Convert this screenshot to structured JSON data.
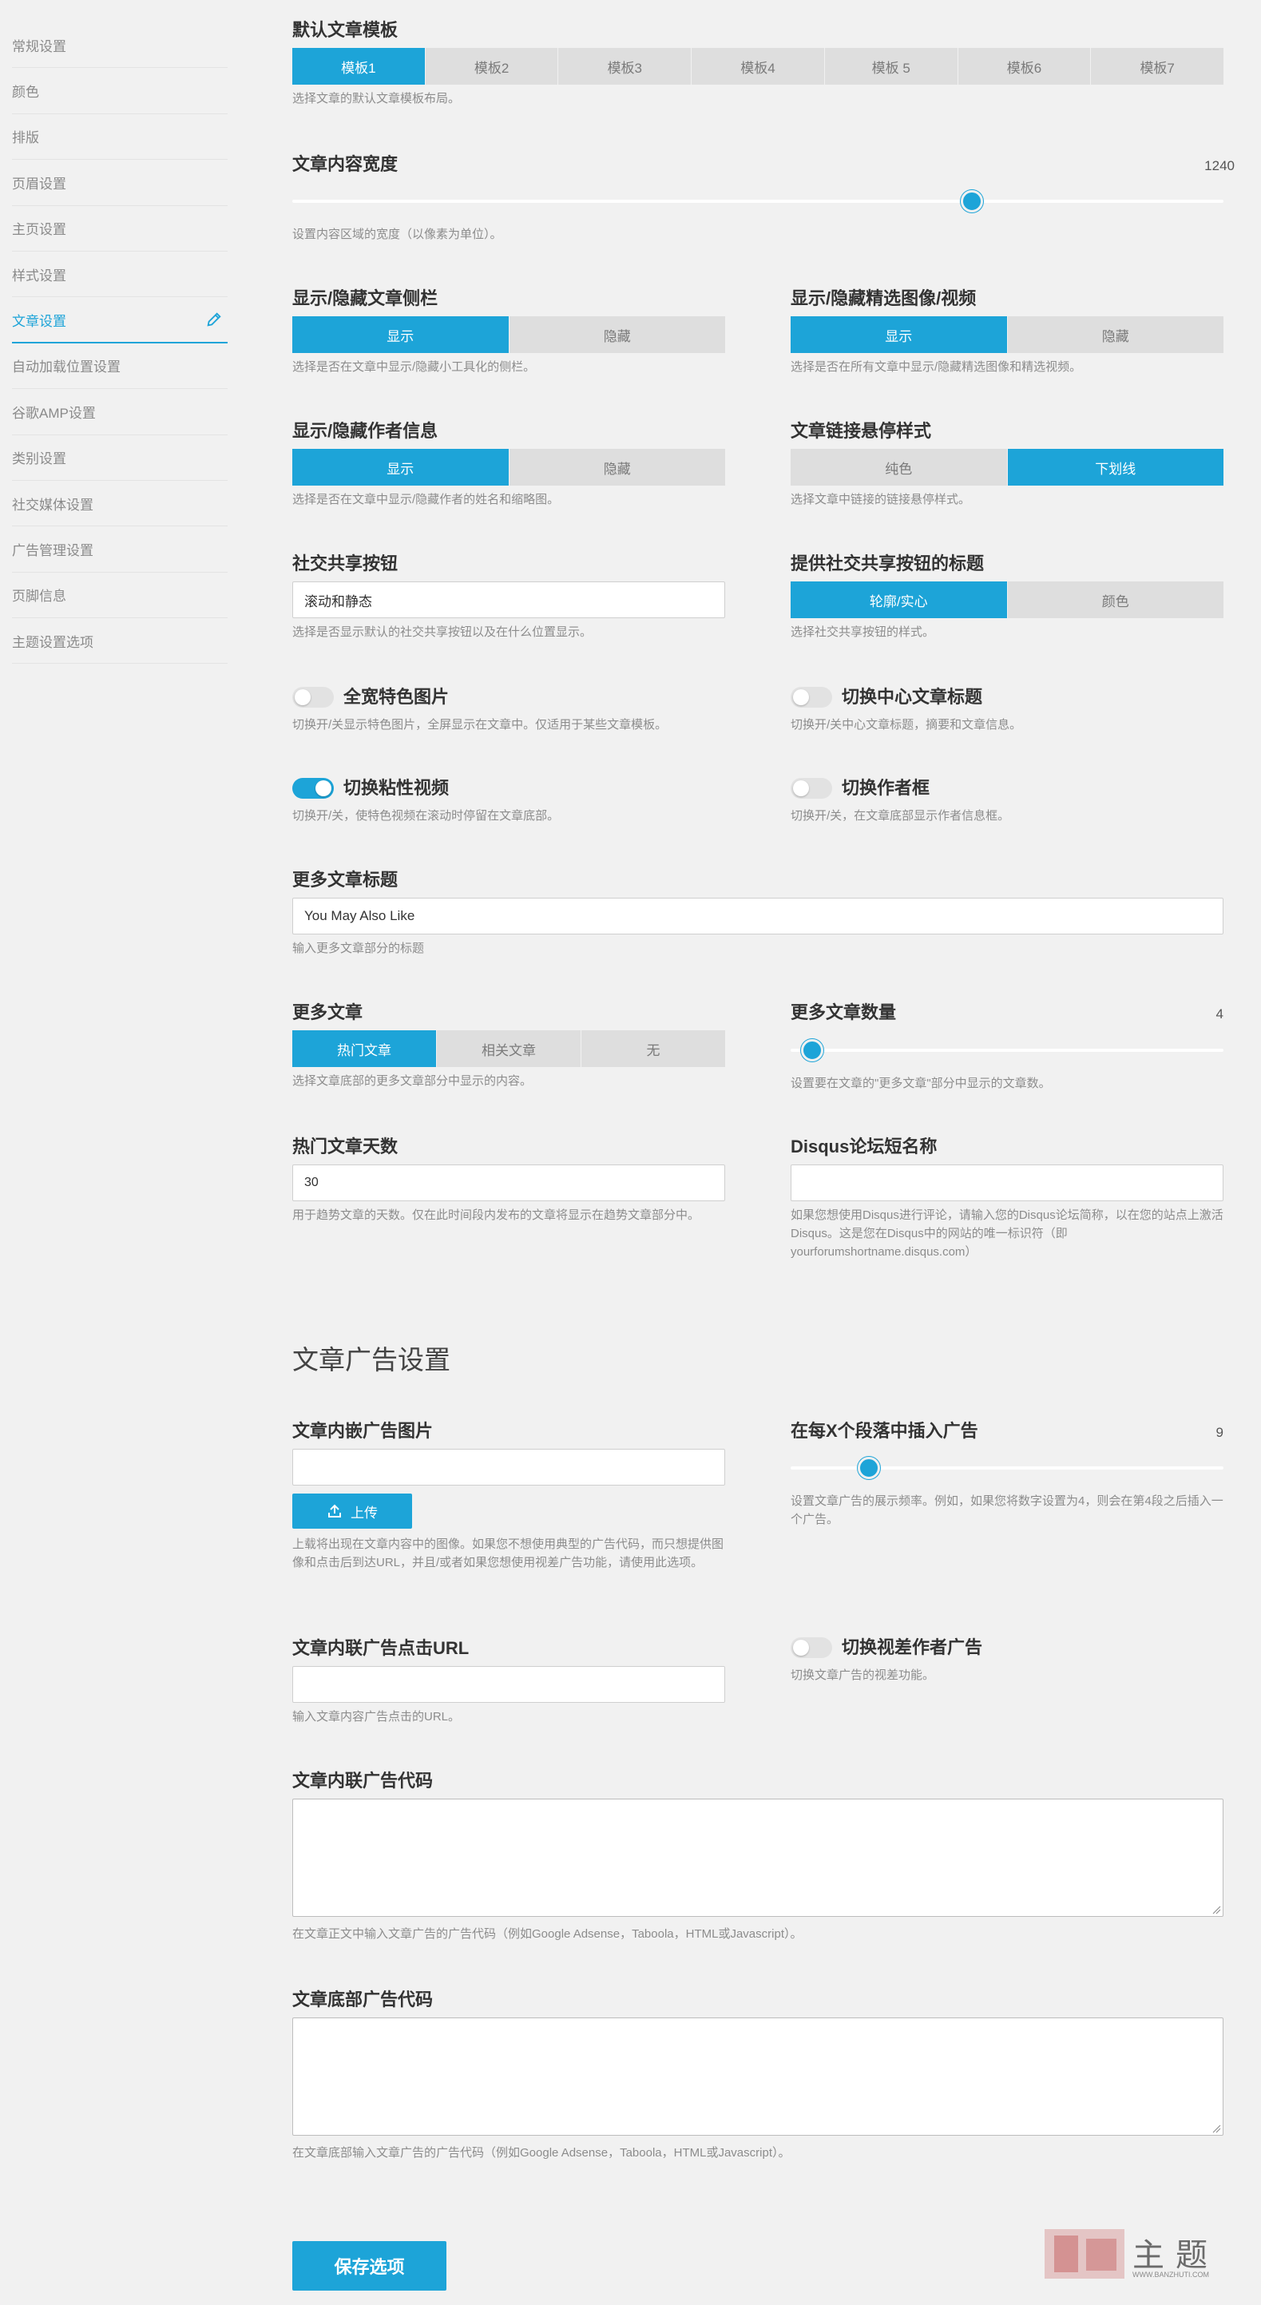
{
  "sidebar": {
    "items": [
      {
        "label": "常规设置"
      },
      {
        "label": "颜色"
      },
      {
        "label": "排版"
      },
      {
        "label": "页眉设置"
      },
      {
        "label": "主页设置"
      },
      {
        "label": "样式设置"
      },
      {
        "label": "文章设置",
        "active": true
      },
      {
        "label": "自动加载位置设置"
      },
      {
        "label": "谷歌AMP设置"
      },
      {
        "label": "类别设置"
      },
      {
        "label": "社交媒体设置"
      },
      {
        "label": "广告管理设置"
      },
      {
        "label": "页脚信息"
      },
      {
        "label": "主题设置选项"
      }
    ]
  },
  "template": {
    "label": "默认文章模板",
    "options": [
      "模板1",
      "模板2",
      "模板3",
      "模板4",
      "模板 5",
      "模板6",
      "模板7"
    ],
    "selected": 0,
    "desc": "选择文章的默认文章模板布局。"
  },
  "content_width": {
    "label": "文章内容宽度",
    "value": "1240",
    "fraction": 0.73,
    "desc": "设置内容区域的宽度（以像素为单位）。"
  },
  "sidebar_toggle": {
    "label": "显示/隐藏文章侧栏",
    "options": [
      "显示",
      "隐藏"
    ],
    "desc": "选择是否在文章中显示/隐藏小工具化的侧栏。"
  },
  "featured_toggle": {
    "label": "显示/隐藏精选图像/视频",
    "options": [
      "显示",
      "隐藏"
    ],
    "desc": "选择是否在所有文章中显示/隐藏精选图像和精选视频。"
  },
  "author_info": {
    "label": "显示/隐藏作者信息",
    "options": [
      "显示",
      "隐藏"
    ],
    "desc": "选择是否在文章中显示/隐藏作者的姓名和缩略图。"
  },
  "link_hover": {
    "label": "文章链接悬停样式",
    "options": [
      "纯色",
      "下划线"
    ],
    "desc": "选择文章中链接的链接悬停样式。"
  },
  "share_buttons": {
    "label": "社交共享按钮",
    "value": "滚动和静态",
    "desc": "选择是否显示默认的社交共享按钮以及在什么位置显示。"
  },
  "share_title": {
    "label": "提供社交共享按钮的标题",
    "options": [
      "轮廓/实心",
      "颜色"
    ],
    "desc": "选择社交共享按钮的样式。"
  },
  "full_width_image": {
    "label": "全宽特色图片",
    "on": false,
    "desc": "切换开/关显示特色图片，全屏显示在文章中。仅适用于某些文章模板。"
  },
  "center_title": {
    "label": "切换中心文章标题",
    "on": false,
    "desc": "切换开/关中心文章标题，摘要和文章信息。"
  },
  "sticky_video": {
    "label": "切换粘性视频",
    "on": true,
    "desc": "切换开/关，使特色视频在滚动时停留在文章底部。"
  },
  "author_box": {
    "label": "切换作者框",
    "on": false,
    "desc": "切换开/关，在文章底部显示作者信息框。"
  },
  "more_title": {
    "label": "更多文章标题",
    "value": "You May Also Like",
    "desc": "输入更多文章部分的标题"
  },
  "more_posts": {
    "label": "更多文章",
    "options": [
      "热门文章",
      "相关文章",
      "无"
    ],
    "desc": "选择文章底部的更多文章部分中显示的内容。"
  },
  "more_count": {
    "label": "更多文章数量",
    "value": "4",
    "fraction": 0.05,
    "desc": "设置要在文章的\"更多文章\"部分中显示的文章数。"
  },
  "hot_days": {
    "label": "热门文章天数",
    "value": "30",
    "desc": "用于趋势文章的天数。仅在此时间段内发布的文章将显示在趋势文章部分中。"
  },
  "disqus": {
    "label": "Disqus论坛短名称",
    "value": "",
    "desc": "如果您想使用Disqus进行评论，请输入您的Disqus论坛简称，以在您的站点上激活Disqus。这是您在Disqus中的网站的唯一标识符（即yourforumshortname.disqus.com）"
  },
  "ads_section": {
    "title": "文章广告设置"
  },
  "inline_ad_image": {
    "label": "文章内嵌广告图片",
    "value": "",
    "upload": "上传",
    "desc": "上载将出现在文章内容中的图像。如果您不想使用典型的广告代码，而只想提供图像和点击后到达URL，并且/或者如果您想使用视差广告功能，请使用此选项。"
  },
  "ad_every": {
    "label": "在每X个段落中插入广告",
    "value": "9",
    "fraction": 0.18,
    "desc": "设置文章广告的展示频率。例如，如果您将数字设置为4，则会在第4段之后插入一个广告。"
  },
  "inline_ad_url": {
    "label": "文章内联广告点击URL",
    "value": "",
    "desc": "输入文章内容广告点击的URL。"
  },
  "parallax_ad": {
    "label": "切换视差作者广告",
    "on": false,
    "desc": "切换文章广告的视差功能。"
  },
  "inline_ad_code": {
    "label": "文章内联广告代码",
    "value": "",
    "desc": "在文章正文中输入文章广告的广告代码（例如Google Adsense，Taboola，HTML或Javascript）。"
  },
  "bottom_ad_code": {
    "label": "文章底部广告代码",
    "value": "",
    "desc": "在文章底部输入文章广告的广告代码（例如Google Adsense，Taboola，HTML或Javascript）。"
  },
  "save": {
    "label": "保存选项"
  },
  "watermark": {
    "text": "主题",
    "sub": "WWW.BANZHUTI.COM"
  },
  "colors": {
    "accent": "#1da4d8",
    "bg": "#f1f1f1",
    "segment_off": "#dedede"
  }
}
